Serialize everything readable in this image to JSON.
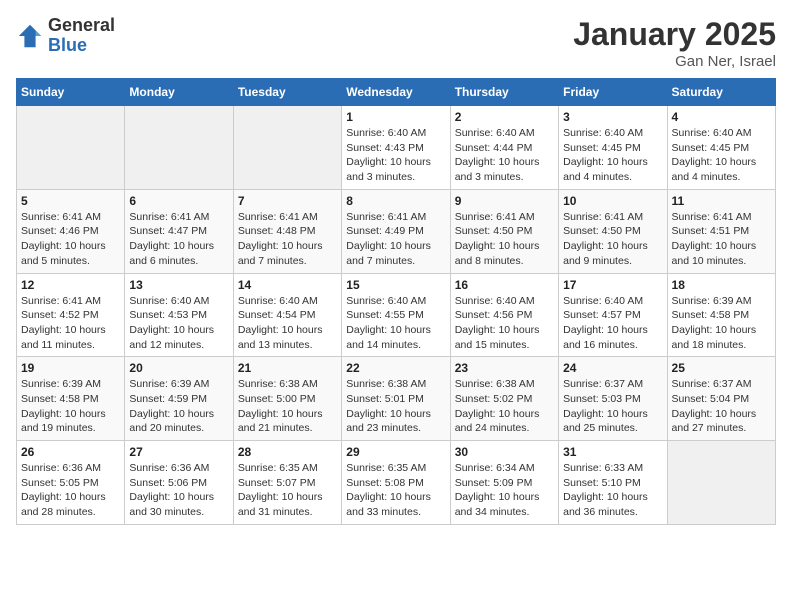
{
  "logo": {
    "general": "General",
    "blue": "Blue"
  },
  "title": "January 2025",
  "subtitle": "Gan Ner, Israel",
  "days_of_week": [
    "Sunday",
    "Monday",
    "Tuesday",
    "Wednesday",
    "Thursday",
    "Friday",
    "Saturday"
  ],
  "weeks": [
    [
      {
        "day": "",
        "info": ""
      },
      {
        "day": "",
        "info": ""
      },
      {
        "day": "",
        "info": ""
      },
      {
        "day": "1",
        "info": "Sunrise: 6:40 AM\nSunset: 4:43 PM\nDaylight: 10 hours\nand 3 minutes."
      },
      {
        "day": "2",
        "info": "Sunrise: 6:40 AM\nSunset: 4:44 PM\nDaylight: 10 hours\nand 3 minutes."
      },
      {
        "day": "3",
        "info": "Sunrise: 6:40 AM\nSunset: 4:45 PM\nDaylight: 10 hours\nand 4 minutes."
      },
      {
        "day": "4",
        "info": "Sunrise: 6:40 AM\nSunset: 4:45 PM\nDaylight: 10 hours\nand 4 minutes."
      }
    ],
    [
      {
        "day": "5",
        "info": "Sunrise: 6:41 AM\nSunset: 4:46 PM\nDaylight: 10 hours\nand 5 minutes."
      },
      {
        "day": "6",
        "info": "Sunrise: 6:41 AM\nSunset: 4:47 PM\nDaylight: 10 hours\nand 6 minutes."
      },
      {
        "day": "7",
        "info": "Sunrise: 6:41 AM\nSunset: 4:48 PM\nDaylight: 10 hours\nand 7 minutes."
      },
      {
        "day": "8",
        "info": "Sunrise: 6:41 AM\nSunset: 4:49 PM\nDaylight: 10 hours\nand 7 minutes."
      },
      {
        "day": "9",
        "info": "Sunrise: 6:41 AM\nSunset: 4:50 PM\nDaylight: 10 hours\nand 8 minutes."
      },
      {
        "day": "10",
        "info": "Sunrise: 6:41 AM\nSunset: 4:50 PM\nDaylight: 10 hours\nand 9 minutes."
      },
      {
        "day": "11",
        "info": "Sunrise: 6:41 AM\nSunset: 4:51 PM\nDaylight: 10 hours\nand 10 minutes."
      }
    ],
    [
      {
        "day": "12",
        "info": "Sunrise: 6:41 AM\nSunset: 4:52 PM\nDaylight: 10 hours\nand 11 minutes."
      },
      {
        "day": "13",
        "info": "Sunrise: 6:40 AM\nSunset: 4:53 PM\nDaylight: 10 hours\nand 12 minutes."
      },
      {
        "day": "14",
        "info": "Sunrise: 6:40 AM\nSunset: 4:54 PM\nDaylight: 10 hours\nand 13 minutes."
      },
      {
        "day": "15",
        "info": "Sunrise: 6:40 AM\nSunset: 4:55 PM\nDaylight: 10 hours\nand 14 minutes."
      },
      {
        "day": "16",
        "info": "Sunrise: 6:40 AM\nSunset: 4:56 PM\nDaylight: 10 hours\nand 15 minutes."
      },
      {
        "day": "17",
        "info": "Sunrise: 6:40 AM\nSunset: 4:57 PM\nDaylight: 10 hours\nand 16 minutes."
      },
      {
        "day": "18",
        "info": "Sunrise: 6:39 AM\nSunset: 4:58 PM\nDaylight: 10 hours\nand 18 minutes."
      }
    ],
    [
      {
        "day": "19",
        "info": "Sunrise: 6:39 AM\nSunset: 4:58 PM\nDaylight: 10 hours\nand 19 minutes."
      },
      {
        "day": "20",
        "info": "Sunrise: 6:39 AM\nSunset: 4:59 PM\nDaylight: 10 hours\nand 20 minutes."
      },
      {
        "day": "21",
        "info": "Sunrise: 6:38 AM\nSunset: 5:00 PM\nDaylight: 10 hours\nand 21 minutes."
      },
      {
        "day": "22",
        "info": "Sunrise: 6:38 AM\nSunset: 5:01 PM\nDaylight: 10 hours\nand 23 minutes."
      },
      {
        "day": "23",
        "info": "Sunrise: 6:38 AM\nSunset: 5:02 PM\nDaylight: 10 hours\nand 24 minutes."
      },
      {
        "day": "24",
        "info": "Sunrise: 6:37 AM\nSunset: 5:03 PM\nDaylight: 10 hours\nand 25 minutes."
      },
      {
        "day": "25",
        "info": "Sunrise: 6:37 AM\nSunset: 5:04 PM\nDaylight: 10 hours\nand 27 minutes."
      }
    ],
    [
      {
        "day": "26",
        "info": "Sunrise: 6:36 AM\nSunset: 5:05 PM\nDaylight: 10 hours\nand 28 minutes."
      },
      {
        "day": "27",
        "info": "Sunrise: 6:36 AM\nSunset: 5:06 PM\nDaylight: 10 hours\nand 30 minutes."
      },
      {
        "day": "28",
        "info": "Sunrise: 6:35 AM\nSunset: 5:07 PM\nDaylight: 10 hours\nand 31 minutes."
      },
      {
        "day": "29",
        "info": "Sunrise: 6:35 AM\nSunset: 5:08 PM\nDaylight: 10 hours\nand 33 minutes."
      },
      {
        "day": "30",
        "info": "Sunrise: 6:34 AM\nSunset: 5:09 PM\nDaylight: 10 hours\nand 34 minutes."
      },
      {
        "day": "31",
        "info": "Sunrise: 6:33 AM\nSunset: 5:10 PM\nDaylight: 10 hours\nand 36 minutes."
      },
      {
        "day": "",
        "info": ""
      }
    ]
  ]
}
